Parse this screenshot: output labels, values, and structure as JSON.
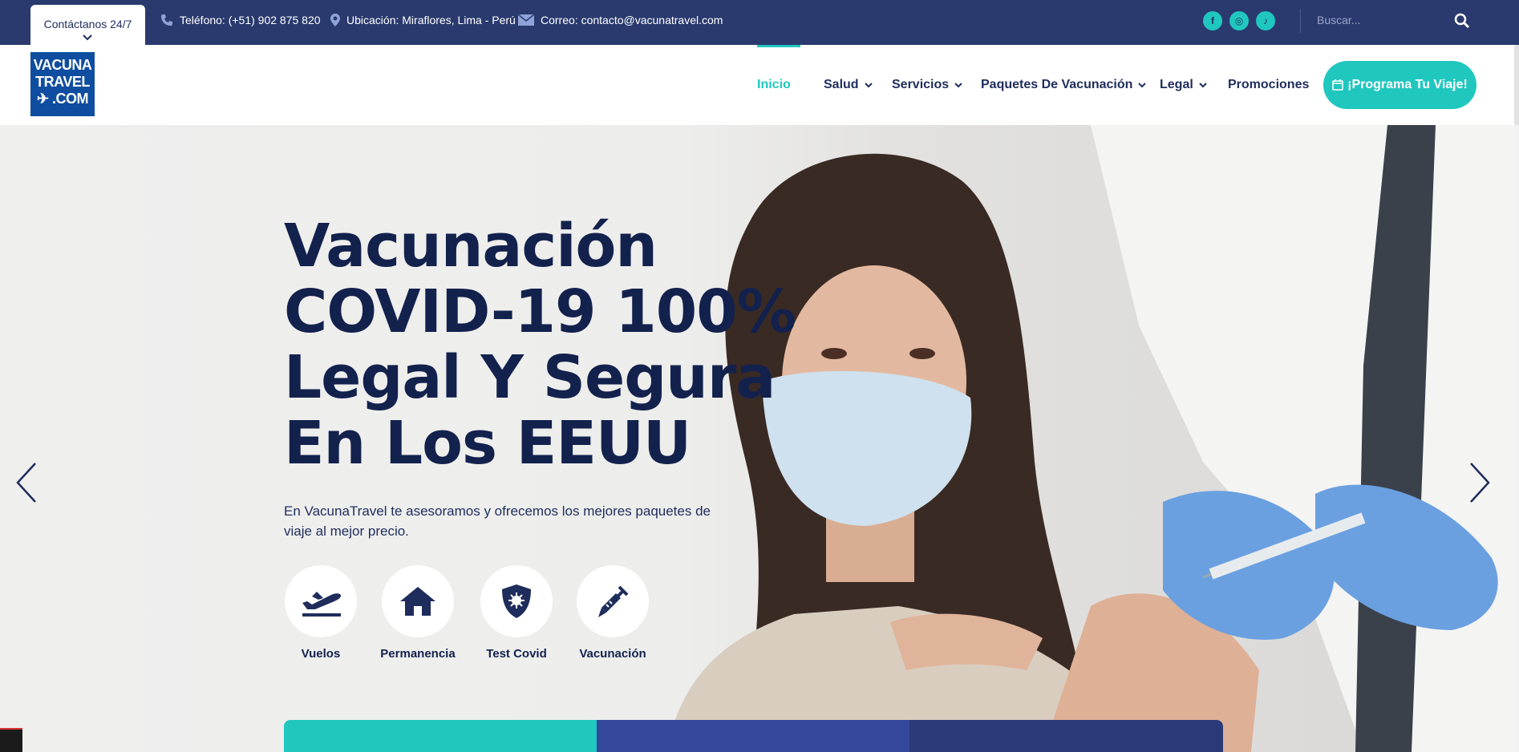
{
  "topbar": {
    "contact_tab": "Contáctanos 24/7",
    "phone": "Teléfono: (+51) 902 875 820",
    "location": "Ubicación: Miraflores, Lima - Perú",
    "email": "Correo: contacto@vacunatravel.com",
    "socials": [
      {
        "icon": "facebook-icon",
        "glyph": "f"
      },
      {
        "icon": "instagram-icon",
        "glyph": "◎"
      },
      {
        "icon": "tiktok-icon",
        "glyph": "♪"
      }
    ],
    "search_placeholder": "Buscar..."
  },
  "logo": {
    "line1": "VACUNA",
    "line2": "TRAVEL",
    "line3": "✈ .COM"
  },
  "nav": {
    "items": [
      {
        "label": "Inicio",
        "active": true,
        "dropdown": false
      },
      {
        "label": "Salud",
        "active": false,
        "dropdown": true
      },
      {
        "label": "Servicios",
        "active": false,
        "dropdown": true
      },
      {
        "label": "Paquetes De Vacunación",
        "active": false,
        "dropdown": true
      },
      {
        "label": "Legal",
        "active": false,
        "dropdown": true
      },
      {
        "label": "Promociones",
        "active": false,
        "dropdown": false
      }
    ],
    "cta": "¡Programa Tu Viaje!"
  },
  "hero": {
    "title": "Vacunación COVID-19 100% Legal Y Segura En Los EEUU",
    "subtitle": "En VacunaTravel te asesoramos y ofrecemos los mejores paquetes de viaje al mejor precio.",
    "services": [
      {
        "label": "Vuelos",
        "icon": "plane-departure-icon"
      },
      {
        "label": "Permanencia",
        "icon": "home-icon"
      },
      {
        "label": "Test Covid",
        "icon": "shield-virus-icon"
      },
      {
        "label": "Vacunación",
        "icon": "syringe-icon"
      }
    ]
  },
  "colors": {
    "primary_dark": "#2a3a6e",
    "accent": "#20c7bf",
    "text_dark": "#13214d"
  }
}
